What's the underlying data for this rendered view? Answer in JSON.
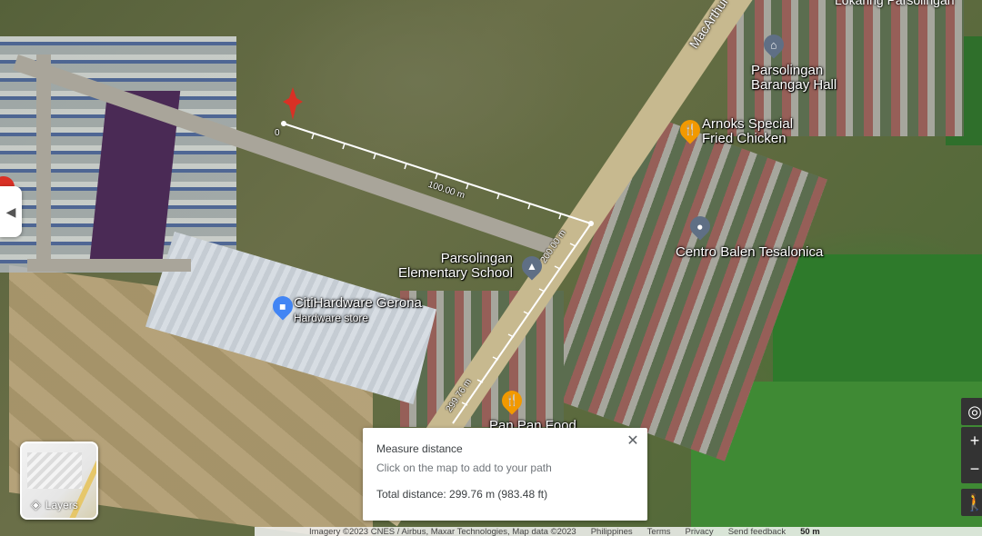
{
  "map": {
    "places": {
      "barangay_hall": {
        "line1": "Parsolingan",
        "line2": "Barangay Hall",
        "color": "#5f6f85",
        "icon": "government-building-icon"
      },
      "arnoks": {
        "line1": "Arnoks Special",
        "line2": "Fried Chicken",
        "color": "#f29900",
        "icon": "restaurant-icon"
      },
      "centro_balen": {
        "name": "Centro Balen Tesalonica",
        "color": "#5f6f85",
        "icon": "landmark-icon"
      },
      "school": {
        "line1": "Parsolingan",
        "line2": "Elementary School",
        "color": "#5f6f85",
        "icon": "school-icon"
      },
      "citihardware": {
        "name": "CitiHardware Gerona",
        "category": "Hardware store",
        "color": "#4285f4",
        "icon": "shopping-bag-icon"
      },
      "panpan": {
        "name": "Pan Pan Food",
        "color": "#f29900",
        "icon": "restaurant-icon"
      }
    },
    "road_labels": {
      "macarthur": "MacArthur",
      "lokaring": "Lokaring Parsolingan"
    },
    "measure_path": {
      "labels": {
        "start": "0",
        "seg1": "100.00 m",
        "seg2": "200.00 m",
        "seg3": "299.76 m"
      },
      "line_color": "#ffffff"
    },
    "pin_color": "#d93025"
  },
  "measure_card": {
    "title": "Measure distance",
    "hint": "Click on the map to add to your path",
    "total": "Total distance: 299.76 m (983.48 ft)",
    "close_icon": "close-icon"
  },
  "layers": {
    "label": "Layers"
  },
  "bottom_bar": {
    "attribution": "Imagery ©2023 CNES / Airbus, Maxar Technologies, Map data ©2023",
    "country": "Philippines",
    "terms": "Terms",
    "privacy": "Privacy",
    "feedback": "Send feedback",
    "scale": "50 m"
  },
  "side_toggle": {
    "icon": "chevron-left-icon"
  }
}
